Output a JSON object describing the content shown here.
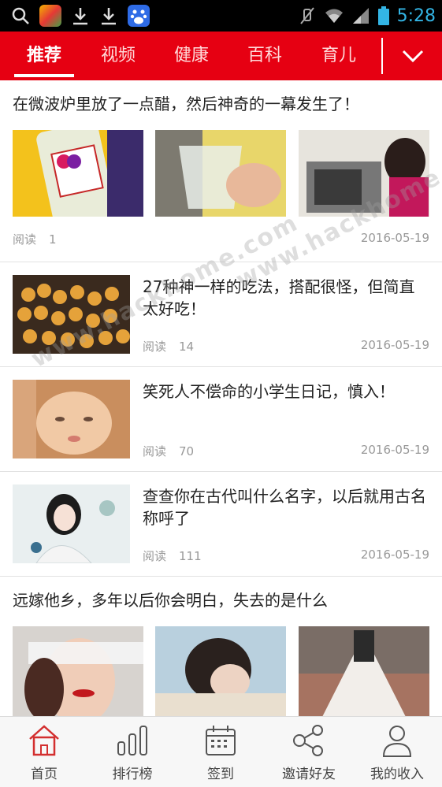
{
  "status_bar": {
    "time": "5:28",
    "icons": [
      "search-icon",
      "app-icon",
      "download-icon",
      "download-icon",
      "baidu-icon",
      "mute-icon",
      "wifi-icon",
      "signal-icon",
      "battery-icon"
    ]
  },
  "tabs": [
    {
      "label": "推荐",
      "active": true
    },
    {
      "label": "视频",
      "active": false
    },
    {
      "label": "健康",
      "active": false
    },
    {
      "label": "百科",
      "active": false
    },
    {
      "label": "育儿",
      "active": false
    }
  ],
  "more_icon": "chevron-down-icon",
  "articles": [
    {
      "title": "在微波炉里放了一点醋，然后神奇的一幕发生了！",
      "read_label": "阅读",
      "reads": "1",
      "date": "2016-05-19"
    },
    {
      "title": "27种神一样的吃法，搭配很怪，但简直太好吃！",
      "read_label": "阅读",
      "reads": "14",
      "date": "2016-05-19"
    },
    {
      "title": "笑死人不偿命的小学生日记，慎入！",
      "read_label": "阅读",
      "reads": "70",
      "date": "2016-05-19"
    },
    {
      "title": "查查你在古代叫什么名字，以后就用古名称呼了",
      "read_label": "阅读",
      "reads": "111",
      "date": "2016-05-19"
    },
    {
      "title": "远嫁他乡，多年以后你会明白，失去的是什么"
    }
  ],
  "watermark": "www.hackhome.com",
  "bottom_nav": [
    {
      "label": "首页",
      "icon": "home-icon",
      "active": true
    },
    {
      "label": "排行榜",
      "icon": "bar-chart-icon",
      "active": false
    },
    {
      "label": "签到",
      "icon": "calendar-icon",
      "active": false
    },
    {
      "label": "邀请好友",
      "icon": "share-icon",
      "active": false
    },
    {
      "label": "我的收入",
      "icon": "user-icon",
      "active": false
    }
  ],
  "colors": {
    "brand_red": "#e60012",
    "status_blue": "#33b5e5"
  }
}
